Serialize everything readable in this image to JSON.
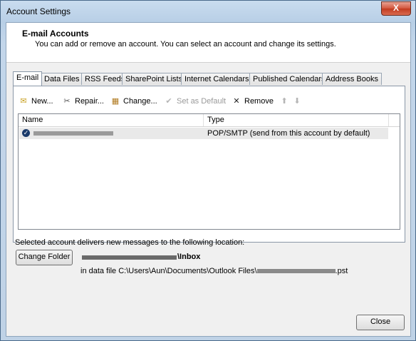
{
  "window": {
    "title": "Account Settings",
    "close_glyph": "X"
  },
  "header": {
    "title": "E-mail Accounts",
    "description": "You can add or remove an account. You can select an account and change its settings."
  },
  "tabs": [
    {
      "label": "E-mail",
      "active": true
    },
    {
      "label": "Data Files"
    },
    {
      "label": "RSS Feeds"
    },
    {
      "label": "SharePoint Lists"
    },
    {
      "label": "Internet Calendars"
    },
    {
      "label": "Published Calendars"
    },
    {
      "label": "Address Books"
    }
  ],
  "toolbar": {
    "new": {
      "label": "New...",
      "icon": "new-account-icon"
    },
    "repair": {
      "label": "Repair...",
      "icon": "repair-icon"
    },
    "change": {
      "label": "Change...",
      "icon": "change-icon"
    },
    "set_default": {
      "label": "Set as Default",
      "icon": "check-circle-icon",
      "enabled": false
    },
    "remove": {
      "label": "Remove",
      "icon": "remove-x-icon"
    },
    "move_up": {
      "icon": "arrow-up-icon",
      "enabled": false
    },
    "move_down": {
      "icon": "arrow-down-icon",
      "enabled": false
    }
  },
  "accounts_list": {
    "columns": [
      "Name",
      "Type"
    ],
    "rows": [
      {
        "name_redacted": true,
        "type": "POP/SMTP (send from this account by default)",
        "is_default": true
      }
    ]
  },
  "delivery": {
    "label": "Selected account delivers new messages to the following location:",
    "change_folder_label": "Change Folder",
    "folder": "\\Inbox",
    "data_file_prefix": "in data file C:\\Users\\Aun\\Documents\\Outlook Files\\",
    "data_file_suffix": ".pst"
  },
  "footer": {
    "close_label": "Close"
  },
  "colors": {
    "title_bar": "#c3d6ea",
    "client_bg": "#f0f0f0",
    "close_red": "#c23b1f",
    "default_check": "#1a3a6a"
  }
}
